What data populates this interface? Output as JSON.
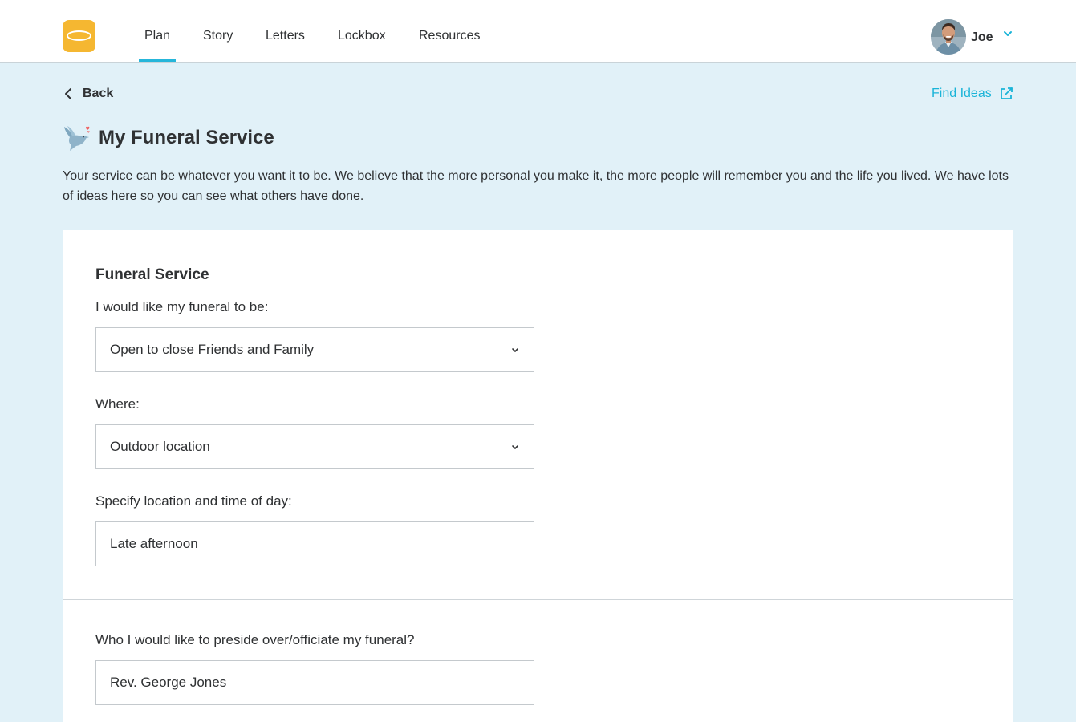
{
  "nav": {
    "items": [
      {
        "label": "Plan",
        "active": true
      },
      {
        "label": "Story"
      },
      {
        "label": "Letters"
      },
      {
        "label": "Lockbox"
      },
      {
        "label": "Resources"
      }
    ]
  },
  "user": {
    "name": "Joe"
  },
  "toolbar": {
    "back_label": "Back",
    "find_ideas_label": "Find Ideas"
  },
  "page": {
    "title": "My Funeral Service",
    "intro": "Your service can be whatever you want it to be. We believe that the more personal you make it, the more people will remember you and the life you lived. We have lots of ideas here so you can see what others have done."
  },
  "form": {
    "section_heading": "Funeral Service",
    "funeral_type": {
      "label": "I would like my funeral to be:",
      "value": "Open to close Friends and Family"
    },
    "where": {
      "label": "Where:",
      "value": "Outdoor location"
    },
    "location_time": {
      "label": "Specify location and time of day:",
      "value": "Late afternoon"
    },
    "officiant": {
      "label": "Who I would like to preside over/officiate my funeral?",
      "value": "Rev. George Jones"
    }
  },
  "icons": {
    "logo": "halo-logo",
    "back": "chevron-left-icon",
    "find_ideas": "external-link-icon",
    "title": "dove-icon",
    "user_menu": "chevron-down-icon",
    "select": "chevron-down-icon"
  },
  "colors": {
    "accent": "#1ab4d8",
    "nav_active_underline": "#26b6da",
    "logo": "#f5b731",
    "background": "#e1f1f8",
    "card": "#ffffff",
    "text": "#2f3133"
  }
}
